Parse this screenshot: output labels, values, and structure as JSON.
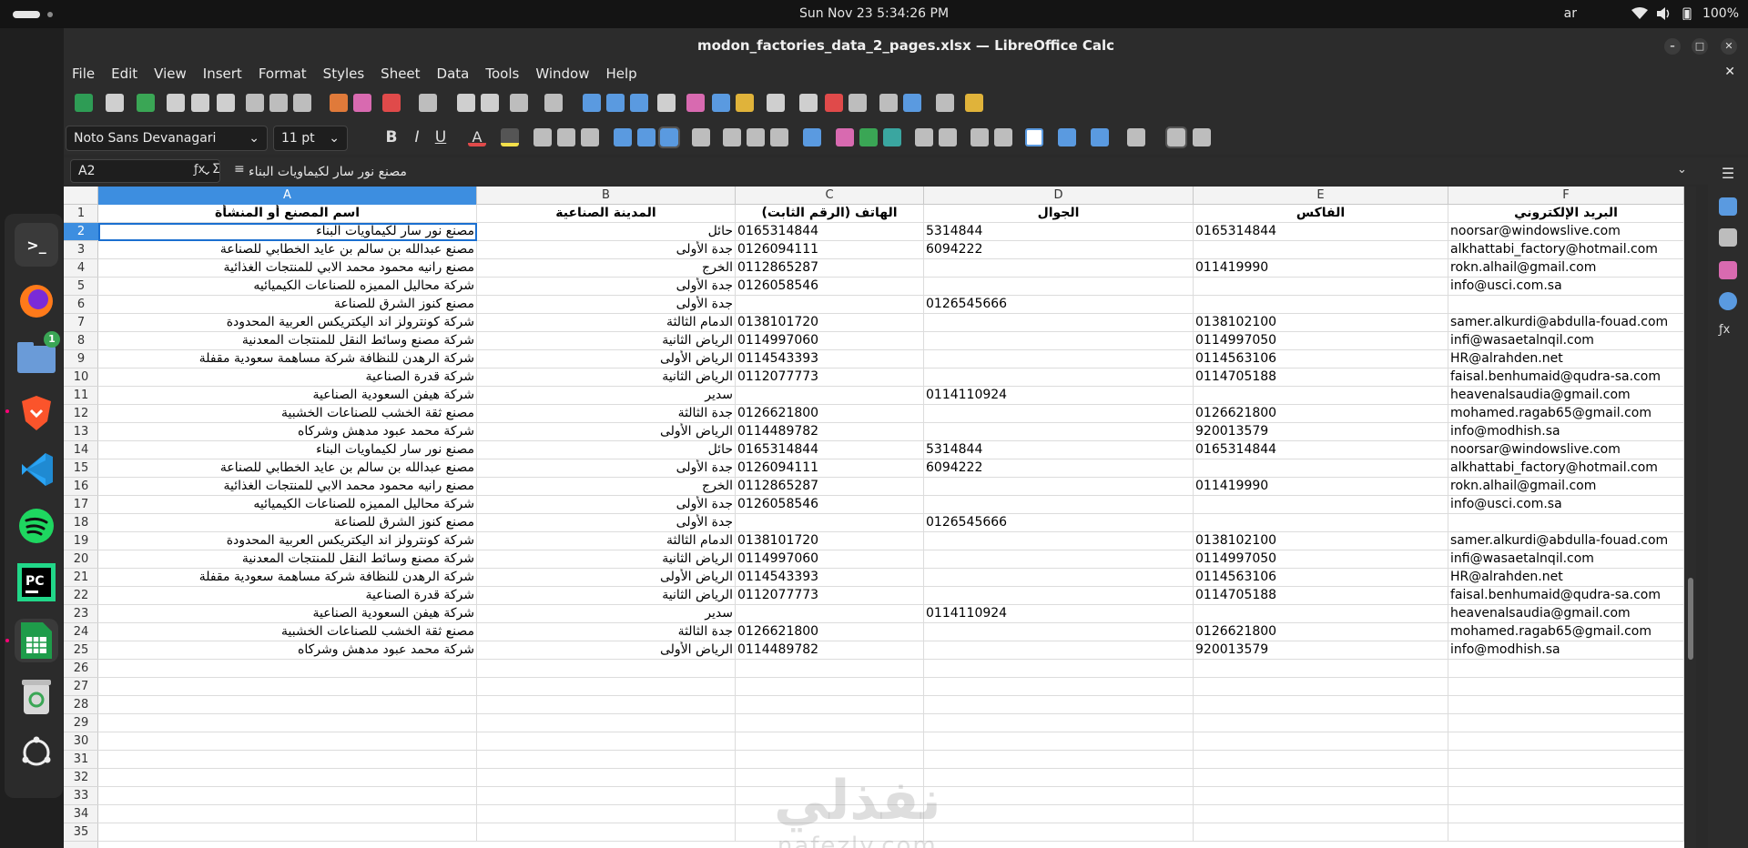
{
  "topbar": {
    "clock": "Sun Nov 23    5:34:26 PM",
    "lang": "ar",
    "battery": "100%"
  },
  "window": {
    "title": "modon_factories_data_2_pages.xlsx — LibreOffice Calc"
  },
  "dock": {
    "files_badge": "1"
  },
  "menu": [
    "File",
    "Edit",
    "View",
    "Insert",
    "Format",
    "Styles",
    "Sheet",
    "Data",
    "Tools",
    "Window",
    "Help"
  ],
  "format": {
    "font_name": "Noto Sans Devanagari",
    "font_size": "11 pt"
  },
  "formula_bar": {
    "name_box": "A2",
    "content": "مصنع نور سار لكيماويات البناء"
  },
  "columns": [
    "A",
    "B",
    "C",
    "D",
    "E",
    "F"
  ],
  "headers": [
    "اسم المصنع أو المنشأة",
    "المدينة الصناعية",
    "الهاتف (الرقم الثابت)",
    "الجوال",
    "الفاكس",
    "البريد الإلكتروني"
  ],
  "rows": [
    [
      "مصنع نور سار لكيماويات البناء",
      "حائل",
      "0165314844",
      "5314844",
      "0165314844",
      "noorsar@windowslive.com"
    ],
    [
      "مصنع عبدالله بن سالم بن عايد الخطابي للصناعة",
      "جدة الأولى",
      "0126094111",
      "6094222",
      "",
      "alkhattabi_factory@hotmail.com"
    ],
    [
      "مصنع رانيه محمود محمد الابي للمنتجات الغذائية",
      "الخرج",
      "0112865287",
      "",
      "011419990",
      "rokn.alhail@gmail.com"
    ],
    [
      "شركة محاليل المميزه للصناعات الكيميائيه",
      "جدة الأولى",
      "0126058546",
      "",
      "",
      "info@usci.com.sa"
    ],
    [
      "مصنع كنوز الشرق للصناعة",
      "جدة الأولى",
      "",
      "0126545666",
      "",
      ""
    ],
    [
      "شركة كونترولز اند اليكتريكس العربية المحدودة",
      "الدمام الثالثة",
      "0138101720",
      "",
      "0138102100",
      "samer.alkurdi@abdulla-fouad.com"
    ],
    [
      "شركة مصنع وسائط النقل للمنتجات المعدنية",
      "الرياض الثانية",
      "0114997060",
      "",
      "0114997050",
      "infi@wasaetalnqil.com"
    ],
    [
      "شركة الرهدن للنظافة شركة مساهمة سعودية مقفلة",
      "الرياض الأولى",
      "0114543393",
      "",
      "0114563106",
      "HR@alrahden.net"
    ],
    [
      "شركة قدرة الصناعية",
      "الرياض الثانية",
      "0112077773",
      "",
      "0114705188",
      "faisal.benhumaid@qudra-sa.com"
    ],
    [
      "شركة هيفن السعودية الصناعية",
      "سدير",
      "",
      "0114110924",
      "",
      "heavenalsaudia@gmail.com"
    ],
    [
      "مصنع ثقة الخشب للصناعات الخشبية",
      "جدة الثالثة",
      "0126621800",
      "",
      "0126621800",
      "mohamed.ragab65@gmail.com"
    ],
    [
      "شركة محمد عبود مدهش وشركاه",
      "الرياض الأولى",
      "0114489782",
      "",
      "920013579",
      "info@modhish.sa"
    ],
    [
      "مصنع نور سار لكيماويات البناء",
      "حائل",
      "0165314844",
      "5314844",
      "0165314844",
      "noorsar@windowslive.com"
    ],
    [
      "مصنع عبدالله بن سالم بن عايد الخطابي للصناعة",
      "جدة الأولى",
      "0126094111",
      "6094222",
      "",
      "alkhattabi_factory@hotmail.com"
    ],
    [
      "مصنع رانيه محمود محمد الابي للمنتجات الغذائية",
      "الخرج",
      "0112865287",
      "",
      "011419990",
      "rokn.alhail@gmail.com"
    ],
    [
      "شركة محاليل المميزه للصناعات الكيميائيه",
      "جدة الأولى",
      "0126058546",
      "",
      "",
      "info@usci.com.sa"
    ],
    [
      "مصنع كنوز الشرق للصناعة",
      "جدة الأولى",
      "",
      "0126545666",
      "",
      ""
    ],
    [
      "شركة كونترولز اند اليكتريكس العربية المحدودة",
      "الدمام الثالثة",
      "0138101720",
      "",
      "0138102100",
      "samer.alkurdi@abdulla-fouad.com"
    ],
    [
      "شركة مصنع وسائط النقل للمنتجات المعدنية",
      "الرياض الثانية",
      "0114997060",
      "",
      "0114997050",
      "infi@wasaetalnqil.com"
    ],
    [
      "شركة الرهدن للنظافة شركة مساهمة سعودية مقفلة",
      "الرياض الأولى",
      "0114543393",
      "",
      "0114563106",
      "HR@alrahden.net"
    ],
    [
      "شركة قدرة الصناعية",
      "الرياض الثانية",
      "0112077773",
      "",
      "0114705188",
      "faisal.benhumaid@qudra-sa.com"
    ],
    [
      "شركة هيفن السعودية الصناعية",
      "سدير",
      "",
      "0114110924",
      "",
      "heavenalsaudia@gmail.com"
    ],
    [
      "مصنع ثقة الخشب للصناعات الخشبية",
      "جدة الثالثة",
      "0126621800",
      "",
      "0126621800",
      "mohamed.ragab65@gmail.com"
    ],
    [
      "شركة محمد عبود مدهش وشركاه",
      "الرياض الأولى",
      "0114489782",
      "",
      "920013579",
      "info@modhish.sa"
    ]
  ],
  "row_numbers": [
    "1",
    "2",
    "3",
    "4",
    "5",
    "6",
    "7",
    "8",
    "9",
    "10",
    "11",
    "12",
    "13",
    "14",
    "15",
    "16",
    "17",
    "18",
    "19",
    "20",
    "21",
    "22",
    "23",
    "24",
    "25",
    "26",
    "27",
    "28",
    "29",
    "30",
    "31",
    "32",
    "33",
    "34",
    "35"
  ],
  "watermark": {
    "arabic": "نفذلي",
    "latin": "nafezly.com"
  }
}
